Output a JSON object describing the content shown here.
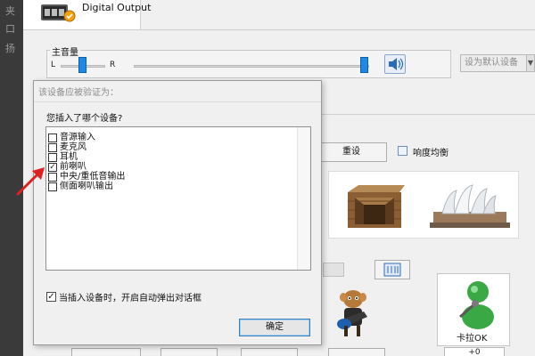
{
  "window": {
    "device_title": "Digital Output"
  },
  "left_strip": {
    "glyphs": [
      "夹",
      "口",
      "扬"
    ]
  },
  "master_volume": {
    "label": "主音量",
    "balance_left": "L",
    "balance_right": "R",
    "volume_level": 0.97,
    "balance_level": 0.5
  },
  "toolbar": {
    "set_default_label": "设为默认设备",
    "set_default_arrow": "▼"
  },
  "effects": {
    "reset_label": "重设",
    "loudness_label": "响度均衡",
    "karaoke_label": "卡拉OK",
    "karaoke_value": "+0"
  },
  "dialog": {
    "title": "该设备应被验证为：",
    "question": "您插入了哪个设备?",
    "options": [
      {
        "label": "音源输入",
        "checked": false
      },
      {
        "label": "麦克风",
        "checked": false
      },
      {
        "label": "耳机",
        "checked": false
      },
      {
        "label": "前喇叭",
        "checked": true
      },
      {
        "label": "中央/重低音输出",
        "checked": false
      },
      {
        "label": "侧面喇叭输出",
        "checked": false
      }
    ],
    "auto_popup": {
      "label": "当插入设备时，开启自动弹出对话框",
      "checked": true
    },
    "ok_label": "确定"
  },
  "colors": {
    "slider_thumb": "#1e8ae6",
    "arrow": "#e02020",
    "ok_border": "#3c7fb1",
    "karaoke_green": "#3aa845"
  }
}
